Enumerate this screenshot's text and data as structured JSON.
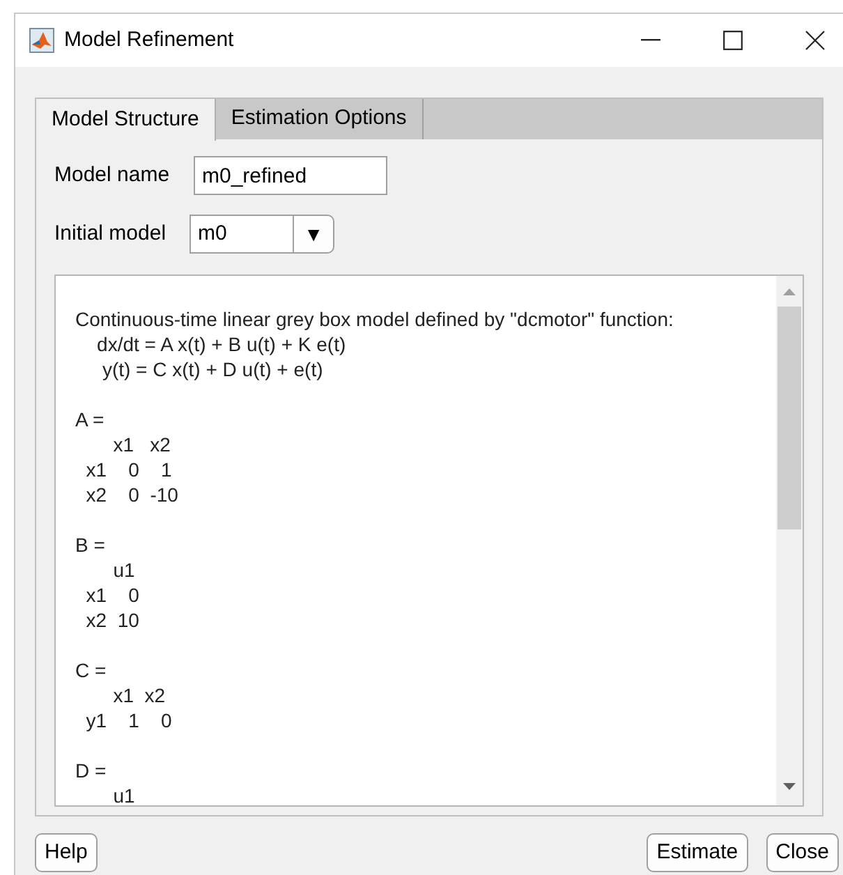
{
  "window": {
    "title": "Model Refinement"
  },
  "tabs": [
    {
      "label": "Model Structure",
      "selected": true
    },
    {
      "label": "Estimation Options",
      "selected": false
    }
  ],
  "model_name": {
    "label": "Model name",
    "value": "m0_refined"
  },
  "initial_model": {
    "label": "Initial model",
    "value": "m0",
    "arrow": "▼"
  },
  "model_display": {
    "blocks": [
      {
        "lines": [
          "Continuous-time linear grey box model defined by \"dcmotor\" function:",
          "    dx/dt = A x(t) + B u(t) + K e(t)",
          "     y(t) = C x(t) + D u(t) + e(t)"
        ]
      },
      {
        "lines": [
          "A = ",
          "       x1   x2",
          "  x1    0    1",
          "  x2    0  -10"
        ]
      },
      {
        "lines": [
          "B = ",
          "       u1",
          "  x1    0",
          "  x2  10"
        ]
      },
      {
        "lines": [
          "C = ",
          "       x1  x2",
          "  y1    1    0"
        ]
      },
      {
        "lines": [
          "D = ",
          "       u1"
        ]
      }
    ]
  },
  "buttons": [
    {
      "label": "Help",
      "kind": "left"
    },
    {
      "label": "Estimate",
      "kind": "right"
    },
    {
      "label": "Close",
      "kind": "right"
    }
  ]
}
